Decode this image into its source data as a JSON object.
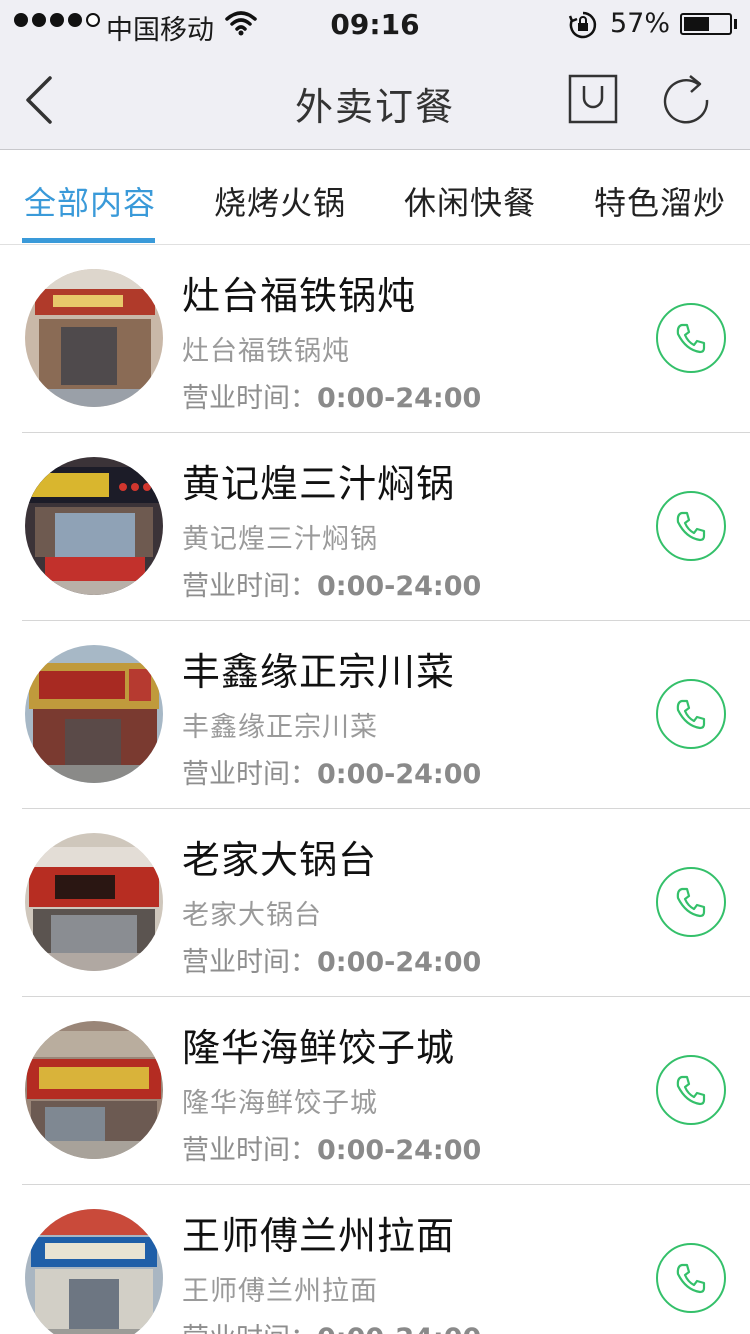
{
  "status_bar": {
    "carrier": "中国移动",
    "time": "09:16",
    "battery_percent": "57%",
    "battery_level": 0.57,
    "signal_icon": "signal-dots-icon",
    "wifi_icon": "wifi-icon",
    "lock_icon": "rotation-lock-icon"
  },
  "navbar": {
    "title": "外卖订餐",
    "back_icon": "chevron-left-icon",
    "bag_icon": "shopping-bag-icon",
    "refresh_icon": "refresh-icon"
  },
  "tabs": [
    {
      "label": "全部内容",
      "active": true
    },
    {
      "label": "烧烤火锅",
      "active": false
    },
    {
      "label": "休闲快餐",
      "active": false
    },
    {
      "label": "特色溜炒",
      "active": false
    }
  ],
  "colors": {
    "accent": "#3a9ad9",
    "call_green": "#34c06a",
    "bar_bg": "#efeff4"
  },
  "hours_label": "营业时间：",
  "restaurants": [
    {
      "name": "灶台福铁锅炖",
      "subtitle": "灶台福铁锅炖",
      "hours": "0:00-24:00"
    },
    {
      "name": "黄记煌三汁焖锅",
      "subtitle": "黄记煌三汁焖锅",
      "hours": "0:00-24:00"
    },
    {
      "name": "丰鑫缘正宗川菜",
      "subtitle": "丰鑫缘正宗川菜",
      "hours": "0:00-24:00"
    },
    {
      "name": "老家大锅台",
      "subtitle": "老家大锅台",
      "hours": "0:00-24:00"
    },
    {
      "name": "隆华海鲜饺子城",
      "subtitle": "隆华海鲜饺子城",
      "hours": "0:00-24:00"
    },
    {
      "name": "王师傅兰州拉面",
      "subtitle": "王师傅兰州拉面",
      "hours": "0:00-24:00"
    }
  ]
}
